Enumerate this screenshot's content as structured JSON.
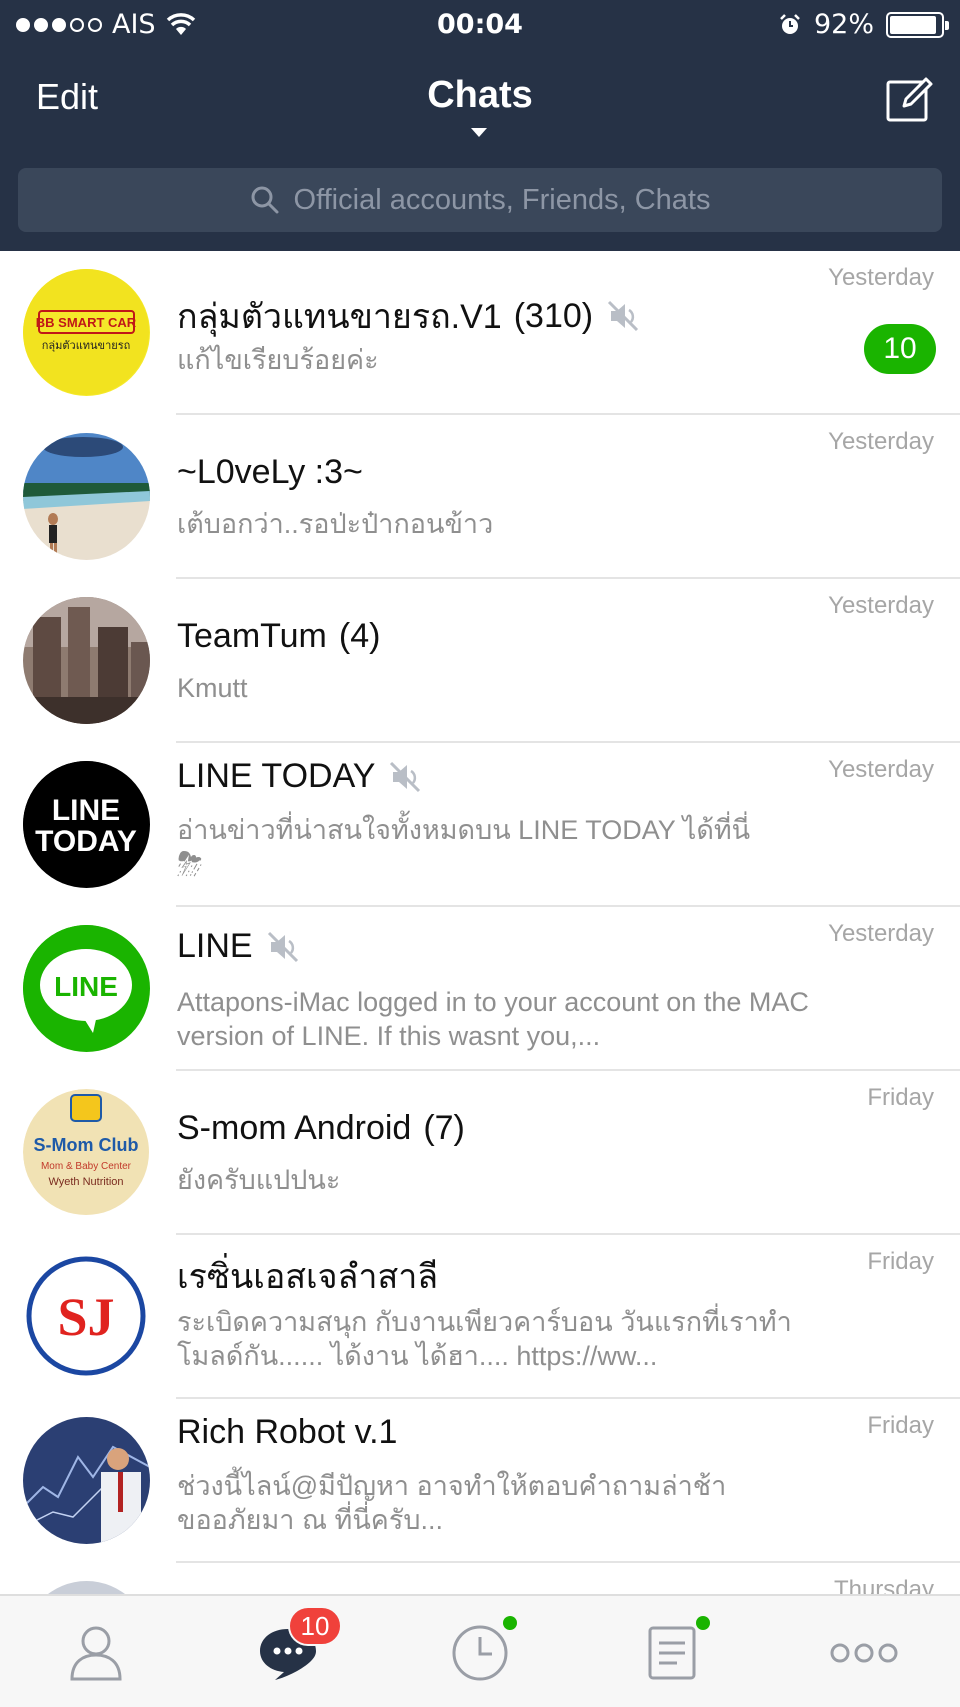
{
  "status_bar": {
    "carrier": "AIS",
    "signal_bars_on": 3,
    "signal_bars_total": 5,
    "time": "00:04",
    "battery": "92%",
    "battery_level": 0.92
  },
  "header": {
    "edit_label": "Edit",
    "title": "Chats",
    "compose_icon": "compose-icon",
    "search_placeholder": "Official accounts, Friends, Chats"
  },
  "colors": {
    "header_bg": "#263246",
    "accent_green": "#1ab400",
    "badge_red": "#f0413b"
  },
  "chats": [
    {
      "name": "กลุ่มตัวแทนขายรถ.V1",
      "count": "(310)",
      "muted": true,
      "preview": "แก้ไขเรียบร้อยค่ะ",
      "time": "Yesterday",
      "unread": "10",
      "avatar": "BB SMART CAR",
      "avatar_sub": "กลุ่มตัวแทนขายรถ"
    },
    {
      "name": "~L0veLy :3~",
      "count": "",
      "muted": false,
      "preview": "เต้บอกว่า..รอป่ะป๋ากอนข้าว",
      "time": "Yesterday",
      "avatar": "beach-photo"
    },
    {
      "name": "TeamTum",
      "count": "(4)",
      "muted": false,
      "preview": "Kmutt",
      "time": "Yesterday",
      "avatar": "city-photo"
    },
    {
      "name": "LINE TODAY",
      "count": "",
      "muted": true,
      "preview": "อ่านข่าวที่น่าสนใจทั้งหมดบน LINE TODAY ได้ที่นี่",
      "preview_emoji": "⛈",
      "time": "Yesterday",
      "avatar_line1": "LINE",
      "avatar_line2": "TODAY"
    },
    {
      "name": "LINE",
      "count": "",
      "muted": true,
      "preview": "Attapons-iMac logged in to your account on the MAC version of LINE. If this wasnt you,...",
      "time": "Yesterday",
      "avatar": "LINE"
    },
    {
      "name": "S-mom Android",
      "count": "(7)",
      "muted": false,
      "preview": "ยังครับแปปนะ",
      "time": "Friday",
      "avatar": "S-Mom Club",
      "avatar_sub": "Mom & Baby Center",
      "avatar_sub2": "Wyeth Nutrition"
    },
    {
      "name": "เรซิ่นเอสเจลำสาลี",
      "count": "",
      "muted": false,
      "preview": "ระเบิดความสนุก  กับงานเพียวคาร์บอน  วันแรกที่เราทำโมลด์กัน...... ได้งาน ได้ฮา.... https://ww...",
      "time": "Friday",
      "avatar": "SJ"
    },
    {
      "name": "Rich Robot v.1",
      "count": "",
      "muted": false,
      "preview": "ช่วงนี้ไลน์@มีปัญหา อาจทำให้ตอบคำถามล่าช้า ขออภัยมา ณ ที่นี่ครับ...",
      "time": "Friday",
      "avatar": "robot-photo"
    },
    {
      "name": "",
      "count": "",
      "muted": false,
      "preview": "",
      "time": "Thursday",
      "avatar": "partial"
    }
  ],
  "tabbar": {
    "items": [
      "friends",
      "chats",
      "timeline",
      "news",
      "more"
    ],
    "chats_badge": "10"
  }
}
